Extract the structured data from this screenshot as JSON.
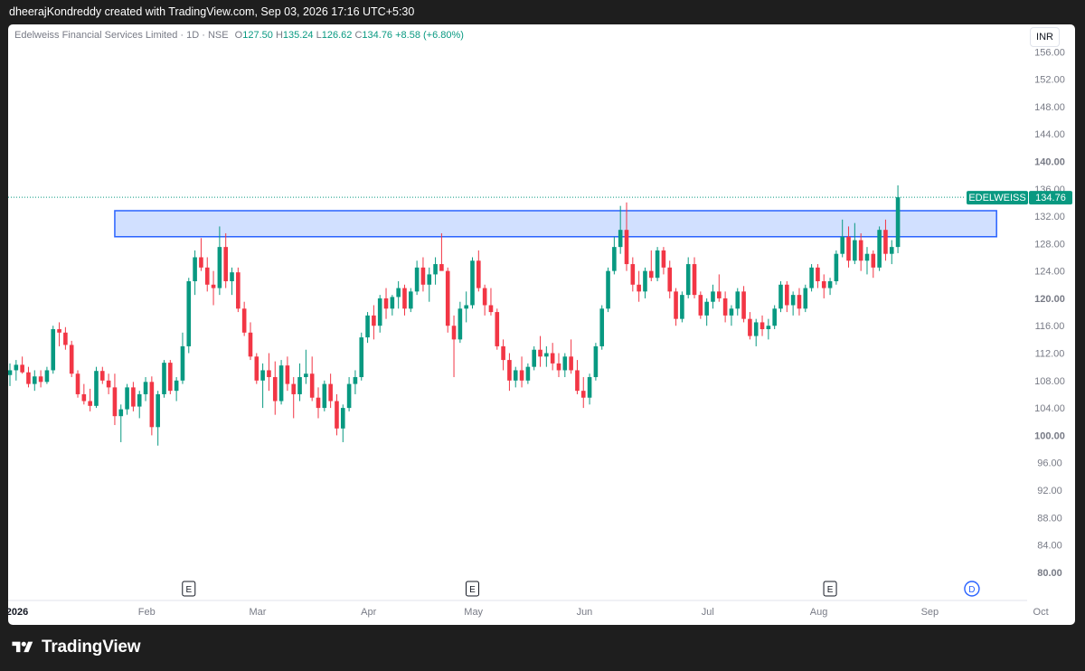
{
  "header": {
    "attribution": "dheerajKondreddy created with TradingView.com, Sep 03, 2026 17:16 UTC+5:30"
  },
  "legend": {
    "symbol": "Edelweiss Financial Services Limited · 1D · NSE",
    "o_label": "O",
    "o_value": "127.50",
    "h_label": "H",
    "h_value": "135.24",
    "l_label": "L",
    "l_value": "126.62",
    "c_label": "C",
    "c_value": "134.76",
    "change": "+8.58 (+6.80%)"
  },
  "currency_button": "INR",
  "footer": {
    "brand": "TradingView"
  },
  "colors": {
    "up": "#089981",
    "down": "#f23645",
    "zone_fill": "#d1e0ff",
    "zone_border": "#2962ff",
    "grid_text": "#787b86"
  },
  "chart_data": {
    "type": "candlestick",
    "symbol_tag": "EDELWEISS",
    "last_price": "134.76",
    "ylim": [
      78,
      160
    ],
    "y_ticks": [
      "156.00",
      "152.00",
      "148.00",
      "144.00",
      "140.00",
      "136.00",
      "132.00",
      "128.00",
      "124.00",
      "120.00",
      "116.00",
      "112.00",
      "108.00",
      "104.00",
      "100.00",
      "96.00",
      "92.00",
      "88.00",
      "84.00",
      "80.00"
    ],
    "x_ticks": [
      {
        "label": "2026",
        "index": 0,
        "bold": true
      },
      {
        "label": "Feb",
        "index": 21
      },
      {
        "label": "Mar",
        "index": 39
      },
      {
        "label": "Apr",
        "index": 57
      },
      {
        "label": "May",
        "index": 74
      },
      {
        "label": "Jun",
        "index": 92
      },
      {
        "label": "Jul",
        "index": 112
      },
      {
        "label": "Aug",
        "index": 130
      },
      {
        "label": "Sep",
        "index": 148
      },
      {
        "label": "Oct",
        "index": 166
      }
    ],
    "zone": {
      "from_index": 17,
      "to_index": 160,
      "top": 132.8,
      "bottom": 129.0
    },
    "event_markers": [
      {
        "label": "E",
        "index": 29
      },
      {
        "label": "E",
        "index": 75
      },
      {
        "label": "E",
        "index": 133
      },
      {
        "label": "D",
        "index": 156
      }
    ],
    "ohlc": [
      [
        108.8,
        110.5,
        107.2,
        109.5
      ],
      [
        109.5,
        111.0,
        108.0,
        110.3
      ],
      [
        110.3,
        111.5,
        109.0,
        109.2
      ],
      [
        109.2,
        110.0,
        107.0,
        107.5
      ],
      [
        107.5,
        109.5,
        106.5,
        108.6
      ],
      [
        108.6,
        109.5,
        107.0,
        107.8
      ],
      [
        107.8,
        110.0,
        107.5,
        109.5
      ],
      [
        109.5,
        116.0,
        109.0,
        115.5
      ],
      [
        115.5,
        116.5,
        113.0,
        115.0
      ],
      [
        115.0,
        115.8,
        112.5,
        113.2
      ],
      [
        113.2,
        113.8,
        108.5,
        109.0
      ],
      [
        109.0,
        109.5,
        105.5,
        106.0
      ],
      [
        106.0,
        107.5,
        104.5,
        105.0
      ],
      [
        105.0,
        106.8,
        103.5,
        104.3
      ],
      [
        104.3,
        110.0,
        104.0,
        109.4
      ],
      [
        109.4,
        110.0,
        107.5,
        108.0
      ],
      [
        108.0,
        109.0,
        106.0,
        107.0
      ],
      [
        107.0,
        109.0,
        101.5,
        102.8
      ],
      [
        102.8,
        104.5,
        99.0,
        103.8
      ],
      [
        103.8,
        107.5,
        103.0,
        107.0
      ],
      [
        107.0,
        107.8,
        103.5,
        104.2
      ],
      [
        104.2,
        106.5,
        102.5,
        106.0
      ],
      [
        106.0,
        108.5,
        105.0,
        107.8
      ],
      [
        107.8,
        108.6,
        100.0,
        101.2
      ],
      [
        101.2,
        106.5,
        98.5,
        106.0
      ],
      [
        106.0,
        111.0,
        105.5,
        110.6
      ],
      [
        110.6,
        111.0,
        106.0,
        106.5
      ],
      [
        106.5,
        108.5,
        105.0,
        108.0
      ],
      [
        108.0,
        115.0,
        107.5,
        113.0
      ],
      [
        113.0,
        123.0,
        112.0,
        122.5
      ],
      [
        122.5,
        127.0,
        120.5,
        126.0
      ],
      [
        126.0,
        128.8,
        124.0,
        124.5
      ],
      [
        124.5,
        126.0,
        121.0,
        122.0
      ],
      [
        122.0,
        124.0,
        119.0,
        121.5
      ],
      [
        121.5,
        130.5,
        120.5,
        127.5
      ],
      [
        127.5,
        129.5,
        121.5,
        122.5
      ],
      [
        122.5,
        124.5,
        120.5,
        123.8
      ],
      [
        123.8,
        124.5,
        118.0,
        118.5
      ],
      [
        118.5,
        119.5,
        114.5,
        115.0
      ],
      [
        115.0,
        116.5,
        111.0,
        111.5
      ],
      [
        111.5,
        112.0,
        107.5,
        108.0
      ],
      [
        108.0,
        110.5,
        104.0,
        109.5
      ],
      [
        109.5,
        112.0,
        106.5,
        108.5
      ],
      [
        108.5,
        110.8,
        103.0,
        105.0
      ],
      [
        105.0,
        111.0,
        104.5,
        110.2
      ],
      [
        110.2,
        111.5,
        106.5,
        107.5
      ],
      [
        107.5,
        108.5,
        102.5,
        106.0
      ],
      [
        106.0,
        110.5,
        105.0,
        108.5
      ],
      [
        108.5,
        112.5,
        107.5,
        109.0
      ],
      [
        109.0,
        111.5,
        105.0,
        105.5
      ],
      [
        105.5,
        107.0,
        102.5,
        104.0
      ],
      [
        104.0,
        108.0,
        103.5,
        107.5
      ],
      [
        107.5,
        109.0,
        104.0,
        105.0
      ],
      [
        105.0,
        106.0,
        100.0,
        101.0
      ],
      [
        101.0,
        104.5,
        99.0,
        104.0
      ],
      [
        104.0,
        108.5,
        103.5,
        107.5
      ],
      [
        107.5,
        109.5,
        106.0,
        108.5
      ],
      [
        108.5,
        115.0,
        108.0,
        114.3
      ],
      [
        114.3,
        118.0,
        113.5,
        117.5
      ],
      [
        117.5,
        119.0,
        114.0,
        116.0
      ],
      [
        116.0,
        120.5,
        115.0,
        120.0
      ],
      [
        120.0,
        121.5,
        117.0,
        118.5
      ],
      [
        118.5,
        120.5,
        117.5,
        120.2
      ],
      [
        120.2,
        122.5,
        118.5,
        121.5
      ],
      [
        121.5,
        122.0,
        117.5,
        118.5
      ],
      [
        118.5,
        121.5,
        118.0,
        121.0
      ],
      [
        121.0,
        125.5,
        120.5,
        124.5
      ],
      [
        124.5,
        126.0,
        121.0,
        122.0
      ],
      [
        122.0,
        124.5,
        119.5,
        123.5
      ],
      [
        123.5,
        126.0,
        122.0,
        125.0
      ],
      [
        125.0,
        129.5,
        124.5,
        124.0
      ],
      [
        124.0,
        124.5,
        115.0,
        116.0
      ],
      [
        116.0,
        117.5,
        108.5,
        114.0
      ],
      [
        114.0,
        119.5,
        113.5,
        118.5
      ],
      [
        118.5,
        121.0,
        116.5,
        119.0
      ],
      [
        119.0,
        126.0,
        118.5,
        125.5
      ],
      [
        125.5,
        127.0,
        121.0,
        121.5
      ],
      [
        121.5,
        122.0,
        117.5,
        119.0
      ],
      [
        119.0,
        121.5,
        117.5,
        118.0
      ],
      [
        118.0,
        118.5,
        112.5,
        113.0
      ],
      [
        113.0,
        114.0,
        109.5,
        111.0
      ],
      [
        111.0,
        112.0,
        106.5,
        108.0
      ],
      [
        108.0,
        110.0,
        107.0,
        109.5
      ],
      [
        109.5,
        111.5,
        107.0,
        108.0
      ],
      [
        108.0,
        110.5,
        107.5,
        110.0
      ],
      [
        110.0,
        113.0,
        109.5,
        112.5
      ],
      [
        112.5,
        114.5,
        110.0,
        111.5
      ],
      [
        111.5,
        113.0,
        110.0,
        112.0
      ],
      [
        112.0,
        113.5,
        109.5,
        110.5
      ],
      [
        110.5,
        112.0,
        108.5,
        109.5
      ],
      [
        109.5,
        112.0,
        108.5,
        111.5
      ],
      [
        111.5,
        114.0,
        109.0,
        109.5
      ],
      [
        109.5,
        111.0,
        106.0,
        106.5
      ],
      [
        106.5,
        108.5,
        104.0,
        105.5
      ],
      [
        105.5,
        109.0,
        104.5,
        108.5
      ],
      [
        108.5,
        113.5,
        108.0,
        113.0
      ],
      [
        113.0,
        119.0,
        112.5,
        118.5
      ],
      [
        118.5,
        124.5,
        118.0,
        124.0
      ],
      [
        124.0,
        129.0,
        123.5,
        127.5
      ],
      [
        127.5,
        133.5,
        126.5,
        130.0
      ],
      [
        130.0,
        134.0,
        124.0,
        125.0
      ],
      [
        125.0,
        126.0,
        121.0,
        122.0
      ],
      [
        122.0,
        124.0,
        119.5,
        121.0
      ],
      [
        121.0,
        124.5,
        120.0,
        124.0
      ],
      [
        124.0,
        127.0,
        122.5,
        123.0
      ],
      [
        123.0,
        127.5,
        122.5,
        127.0
      ],
      [
        127.0,
        127.5,
        123.5,
        124.5
      ],
      [
        124.5,
        125.5,
        120.0,
        121.0
      ],
      [
        121.0,
        121.5,
        116.0,
        117.0
      ],
      [
        117.0,
        121.0,
        116.5,
        120.5
      ],
      [
        120.5,
        126.0,
        120.0,
        125.0
      ],
      [
        125.0,
        126.0,
        120.0,
        120.5
      ],
      [
        120.5,
        121.0,
        117.0,
        117.5
      ],
      [
        117.5,
        120.0,
        116.0,
        119.5
      ],
      [
        119.5,
        122.0,
        118.5,
        121.0
      ],
      [
        121.0,
        123.5,
        119.5,
        120.0
      ],
      [
        120.0,
        121.0,
        116.5,
        117.5
      ],
      [
        117.5,
        119.0,
        116.0,
        118.5
      ],
      [
        118.5,
        121.5,
        117.5,
        121.0
      ],
      [
        121.0,
        121.8,
        116.5,
        117.0
      ],
      [
        117.0,
        118.0,
        114.0,
        114.5
      ],
      [
        114.5,
        117.0,
        113.0,
        116.5
      ],
      [
        116.5,
        117.5,
        114.5,
        115.5
      ],
      [
        115.5,
        117.0,
        114.0,
        116.0
      ],
      [
        116.0,
        119.0,
        115.5,
        118.5
      ],
      [
        118.5,
        122.5,
        118.0,
        122.0
      ],
      [
        122.0,
        122.5,
        118.0,
        119.0
      ],
      [
        119.0,
        121.0,
        117.5,
        120.5
      ],
      [
        120.5,
        121.5,
        117.5,
        118.5
      ],
      [
        118.5,
        122.0,
        118.0,
        121.5
      ],
      [
        121.5,
        125.0,
        121.0,
        124.5
      ],
      [
        124.5,
        125.0,
        121.5,
        122.5
      ],
      [
        122.5,
        123.5,
        120.0,
        121.5
      ],
      [
        121.5,
        123.0,
        120.5,
        122.5
      ],
      [
        122.5,
        127.0,
        122.0,
        126.5
      ],
      [
        126.5,
        131.5,
        126.0,
        129.0
      ],
      [
        129.0,
        130.5,
        124.5,
        125.5
      ],
      [
        125.5,
        131.0,
        125.0,
        128.5
      ],
      [
        128.5,
        129.5,
        124.0,
        125.5
      ],
      [
        125.5,
        127.5,
        123.5,
        126.5
      ],
      [
        126.5,
        127.0,
        123.0,
        124.5
      ],
      [
        124.5,
        130.5,
        124.0,
        130.0
      ],
      [
        130.0,
        131.5,
        125.5,
        126.5
      ],
      [
        126.5,
        128.5,
        125.0,
        127.5
      ],
      [
        127.5,
        136.5,
        126.6,
        134.76
      ]
    ]
  }
}
